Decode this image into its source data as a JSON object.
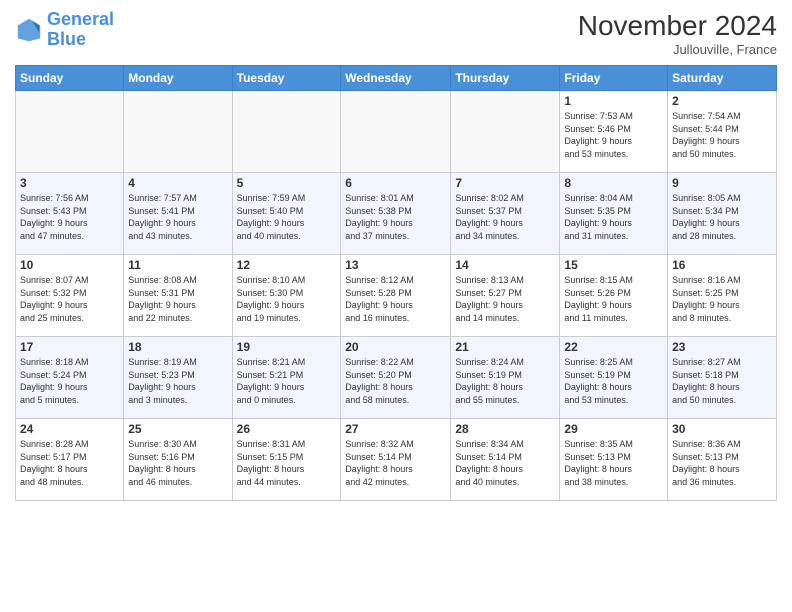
{
  "header": {
    "logo_line1": "General",
    "logo_line2": "Blue",
    "month": "November 2024",
    "location": "Jullouville, France"
  },
  "weekdays": [
    "Sunday",
    "Monday",
    "Tuesday",
    "Wednesday",
    "Thursday",
    "Friday",
    "Saturday"
  ],
  "weeks": [
    [
      {
        "day": "",
        "info": ""
      },
      {
        "day": "",
        "info": ""
      },
      {
        "day": "",
        "info": ""
      },
      {
        "day": "",
        "info": ""
      },
      {
        "day": "",
        "info": ""
      },
      {
        "day": "1",
        "info": "Sunrise: 7:53 AM\nSunset: 5:46 PM\nDaylight: 9 hours\nand 53 minutes."
      },
      {
        "day": "2",
        "info": "Sunrise: 7:54 AM\nSunset: 5:44 PM\nDaylight: 9 hours\nand 50 minutes."
      }
    ],
    [
      {
        "day": "3",
        "info": "Sunrise: 7:56 AM\nSunset: 5:43 PM\nDaylight: 9 hours\nand 47 minutes."
      },
      {
        "day": "4",
        "info": "Sunrise: 7:57 AM\nSunset: 5:41 PM\nDaylight: 9 hours\nand 43 minutes."
      },
      {
        "day": "5",
        "info": "Sunrise: 7:59 AM\nSunset: 5:40 PM\nDaylight: 9 hours\nand 40 minutes."
      },
      {
        "day": "6",
        "info": "Sunrise: 8:01 AM\nSunset: 5:38 PM\nDaylight: 9 hours\nand 37 minutes."
      },
      {
        "day": "7",
        "info": "Sunrise: 8:02 AM\nSunset: 5:37 PM\nDaylight: 9 hours\nand 34 minutes."
      },
      {
        "day": "8",
        "info": "Sunrise: 8:04 AM\nSunset: 5:35 PM\nDaylight: 9 hours\nand 31 minutes."
      },
      {
        "day": "9",
        "info": "Sunrise: 8:05 AM\nSunset: 5:34 PM\nDaylight: 9 hours\nand 28 minutes."
      }
    ],
    [
      {
        "day": "10",
        "info": "Sunrise: 8:07 AM\nSunset: 5:32 PM\nDaylight: 9 hours\nand 25 minutes."
      },
      {
        "day": "11",
        "info": "Sunrise: 8:08 AM\nSunset: 5:31 PM\nDaylight: 9 hours\nand 22 minutes."
      },
      {
        "day": "12",
        "info": "Sunrise: 8:10 AM\nSunset: 5:30 PM\nDaylight: 9 hours\nand 19 minutes."
      },
      {
        "day": "13",
        "info": "Sunrise: 8:12 AM\nSunset: 5:28 PM\nDaylight: 9 hours\nand 16 minutes."
      },
      {
        "day": "14",
        "info": "Sunrise: 8:13 AM\nSunset: 5:27 PM\nDaylight: 9 hours\nand 14 minutes."
      },
      {
        "day": "15",
        "info": "Sunrise: 8:15 AM\nSunset: 5:26 PM\nDaylight: 9 hours\nand 11 minutes."
      },
      {
        "day": "16",
        "info": "Sunrise: 8:16 AM\nSunset: 5:25 PM\nDaylight: 9 hours\nand 8 minutes."
      }
    ],
    [
      {
        "day": "17",
        "info": "Sunrise: 8:18 AM\nSunset: 5:24 PM\nDaylight: 9 hours\nand 5 minutes."
      },
      {
        "day": "18",
        "info": "Sunrise: 8:19 AM\nSunset: 5:23 PM\nDaylight: 9 hours\nand 3 minutes."
      },
      {
        "day": "19",
        "info": "Sunrise: 8:21 AM\nSunset: 5:21 PM\nDaylight: 9 hours\nand 0 minutes."
      },
      {
        "day": "20",
        "info": "Sunrise: 8:22 AM\nSunset: 5:20 PM\nDaylight: 8 hours\nand 58 minutes."
      },
      {
        "day": "21",
        "info": "Sunrise: 8:24 AM\nSunset: 5:19 PM\nDaylight: 8 hours\nand 55 minutes."
      },
      {
        "day": "22",
        "info": "Sunrise: 8:25 AM\nSunset: 5:19 PM\nDaylight: 8 hours\nand 53 minutes."
      },
      {
        "day": "23",
        "info": "Sunrise: 8:27 AM\nSunset: 5:18 PM\nDaylight: 8 hours\nand 50 minutes."
      }
    ],
    [
      {
        "day": "24",
        "info": "Sunrise: 8:28 AM\nSunset: 5:17 PM\nDaylight: 8 hours\nand 48 minutes."
      },
      {
        "day": "25",
        "info": "Sunrise: 8:30 AM\nSunset: 5:16 PM\nDaylight: 8 hours\nand 46 minutes."
      },
      {
        "day": "26",
        "info": "Sunrise: 8:31 AM\nSunset: 5:15 PM\nDaylight: 8 hours\nand 44 minutes."
      },
      {
        "day": "27",
        "info": "Sunrise: 8:32 AM\nSunset: 5:14 PM\nDaylight: 8 hours\nand 42 minutes."
      },
      {
        "day": "28",
        "info": "Sunrise: 8:34 AM\nSunset: 5:14 PM\nDaylight: 8 hours\nand 40 minutes."
      },
      {
        "day": "29",
        "info": "Sunrise: 8:35 AM\nSunset: 5:13 PM\nDaylight: 8 hours\nand 38 minutes."
      },
      {
        "day": "30",
        "info": "Sunrise: 8:36 AM\nSunset: 5:13 PM\nDaylight: 8 hours\nand 36 minutes."
      }
    ]
  ]
}
